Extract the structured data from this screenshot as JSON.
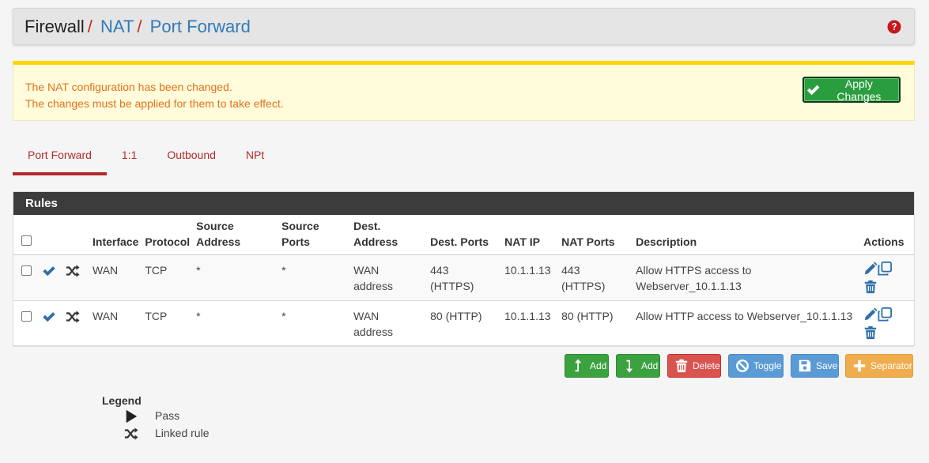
{
  "breadcrumb": {
    "items": [
      "Firewall",
      "NAT",
      "Port Forward"
    ],
    "sep": "/"
  },
  "alert": {
    "line1": "The NAT configuration has been changed.",
    "line2": "The changes must be applied for them to take effect.",
    "apply_label": "Apply Changes"
  },
  "tabs": [
    {
      "label": "Port Forward",
      "active": true
    },
    {
      "label": "1:1"
    },
    {
      "label": "Outbound"
    },
    {
      "label": "NPt"
    }
  ],
  "panel": {
    "title": "Rules",
    "columns": {
      "interface": "Interface",
      "protocol": "Protocol",
      "src_addr": [
        "Source",
        "Address"
      ],
      "src_ports": [
        "Source",
        "Ports"
      ],
      "dest_addr": [
        "Dest.",
        "Address"
      ],
      "dest_ports": "Dest. Ports",
      "nat_ip": "NAT IP",
      "nat_ports": "NAT Ports",
      "description": "Description",
      "actions": "Actions"
    },
    "rows": [
      {
        "interface": "WAN",
        "protocol": "TCP",
        "src_addr": "*",
        "src_ports": "*",
        "dest_addr": [
          "WAN",
          "address"
        ],
        "dest_ports": [
          "443",
          "(HTTPS)"
        ],
        "nat_ip": "10.1.1.13",
        "nat_ports": [
          "443",
          "(HTTPS)"
        ],
        "description": [
          "Allow HTTPS access to",
          "Webserver_10.1.1.13"
        ]
      },
      {
        "interface": "WAN",
        "protocol": "TCP",
        "src_addr": "*",
        "src_ports": "*",
        "dest_addr": [
          "WAN",
          "address"
        ],
        "dest_ports": [
          "80 (HTTP)"
        ],
        "nat_ip": "10.1.1.13",
        "nat_ports": [
          "80 (HTTP)"
        ],
        "description": [
          "Allow HTTP access to Webserver_10.1.1.13"
        ]
      }
    ]
  },
  "buttons": {
    "add_top": "Add",
    "add_bottom": "Add",
    "delete": "Delete",
    "toggle": "Toggle",
    "save": "Save",
    "separator": "Separator"
  },
  "legend": {
    "title": "Legend",
    "pass": "Pass",
    "linked": "Linked rule"
  },
  "colors": {
    "link": "#337ab7",
    "accent_red": "#b22a2a",
    "alert_text": "#e2731c",
    "green": "#3ba23f",
    "red": "#d9534f",
    "blue": "#5b9bd5",
    "orange": "#f0ad4e"
  },
  "icons": {
    "help": "question-circle-icon",
    "check": "check-icon",
    "linked": "random-icon",
    "edit": "pencil-icon",
    "copy": "clone-icon",
    "delete": "trash-icon",
    "add_top": "level-up-icon",
    "add_bottom": "level-down-icon",
    "toggle": "ban-icon",
    "save": "floppy-icon",
    "separator": "plus-icon",
    "pass": "play-icon"
  }
}
